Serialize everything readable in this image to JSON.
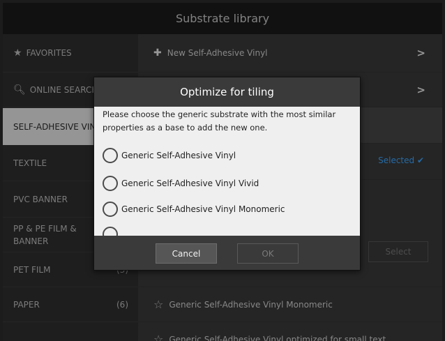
{
  "title": "Substrate library",
  "sidebar": {
    "items": [
      {
        "label": "FAVORITES",
        "icon": "star-icon",
        "count": ""
      },
      {
        "label": "ONLINE SEARCH",
        "icon": "search-icon",
        "count": ""
      },
      {
        "label": "SELF-ADHESIVE VINYL",
        "icon": "",
        "count": ""
      },
      {
        "label": "TEXTILE",
        "icon": "",
        "count": ""
      },
      {
        "label": "PVC BANNER",
        "icon": "",
        "count": ""
      },
      {
        "label": "PP & PE FILM & BANNER",
        "icon": "",
        "count": ""
      },
      {
        "label": "PET FILM",
        "icon": "",
        "count": "(3)"
      },
      {
        "label": "PAPER",
        "icon": "",
        "count": "(6)"
      }
    ]
  },
  "main": {
    "rows": [
      {
        "label": "New Self-Adhesive Vinyl",
        "icon": "plus-icon"
      },
      {
        "label": "",
        "icon": ""
      },
      {
        "label": "Generic Self-Adhesive Vinyl Monomeric",
        "icon": "star-outline-icon"
      },
      {
        "label": "Generic Self-Adhesive Vinyl optimized for small text",
        "icon": "star-outline-icon"
      }
    ],
    "selected_label": "Selected ✔",
    "select_button": "Select"
  },
  "dialog": {
    "title": "Optimize for tiling",
    "message_line1": "Please choose the generic substrate with the most similar",
    "message_line2": "properties as a base to add the new one.",
    "options": [
      "Generic Self-Adhesive Vinyl",
      "Generic Self-Adhesive Vinyl Vivid",
      "Generic Self-Adhesive Vinyl Monomeric"
    ],
    "cancel_label": "Cancel",
    "ok_label": "OK"
  },
  "colors": {
    "accent": "#3aa3ff",
    "title_bg": "#1b1b1b",
    "dialog_bg": "#efefef"
  }
}
